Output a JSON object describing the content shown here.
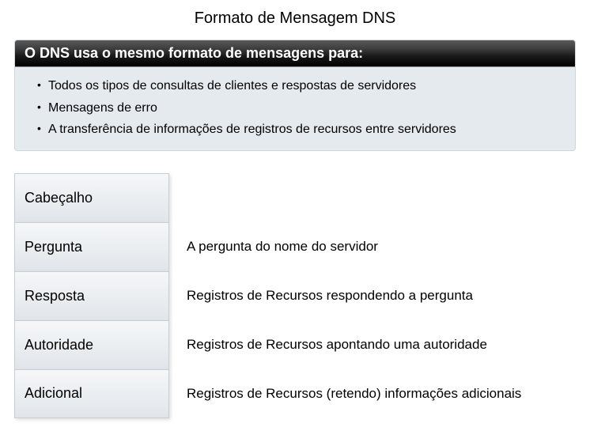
{
  "title": "Formato de Mensagem DNS",
  "panel": {
    "header": "O DNS usa o mesmo formato de mensagens para:",
    "items": [
      "Todos os tipos de consultas de clientes e respostas de servidores",
      "Mensagens de erro",
      "A transferência de informações de registros de recursos entre servidores"
    ]
  },
  "sections": [
    {
      "label": "Cabeçalho",
      "description": ""
    },
    {
      "label": "Pergunta",
      "description": "A pergunta do nome do servidor"
    },
    {
      "label": "Resposta",
      "description": "Registros de Recursos respondendo a pergunta"
    },
    {
      "label": "Autoridade",
      "description": "Registros de Recursos apontando uma autoridade"
    },
    {
      "label": "Adicional",
      "description": "Registros de Recursos (retendo) informações adicionais"
    }
  ]
}
